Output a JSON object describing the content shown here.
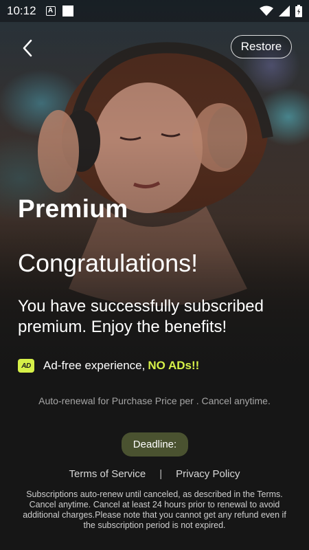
{
  "status_bar": {
    "time": "10:12",
    "notification_icon": "a-box-icon",
    "square_icon": "white-square-icon",
    "wifi_icon": "wifi-icon",
    "signal_icon": "signal-icon",
    "battery_icon": "battery-charging-icon"
  },
  "header": {
    "back_icon": "chevron-left-icon",
    "restore_label": "Restore"
  },
  "content": {
    "premium_title": "Premium",
    "congratulations": "Congratulations!",
    "success_message": "You have successfully subscribed premium. Enjoy the benefits!",
    "benefit": {
      "icon_text": "AD",
      "text": "Ad-free experience,",
      "highlight": "NO ADs!!"
    },
    "renewal_note": "Auto-renewal for Purchase Price per . Cancel anytime.",
    "deadline_label": "Deadline:"
  },
  "footer": {
    "terms_label": "Terms of Service",
    "separator": "|",
    "privacy_label": "Privacy Policy",
    "fine_print": "Subscriptions auto-renew until canceled, as described in the Terms. Cancel anytime. Cancel at least 24 hours prior to renewal to avoid additional charges.Please note that you cannot get any refund even if the subscription period is not expired."
  },
  "colors": {
    "accent": "#d6f048",
    "deadline_bg": "#4a5230",
    "background": "#161616"
  }
}
